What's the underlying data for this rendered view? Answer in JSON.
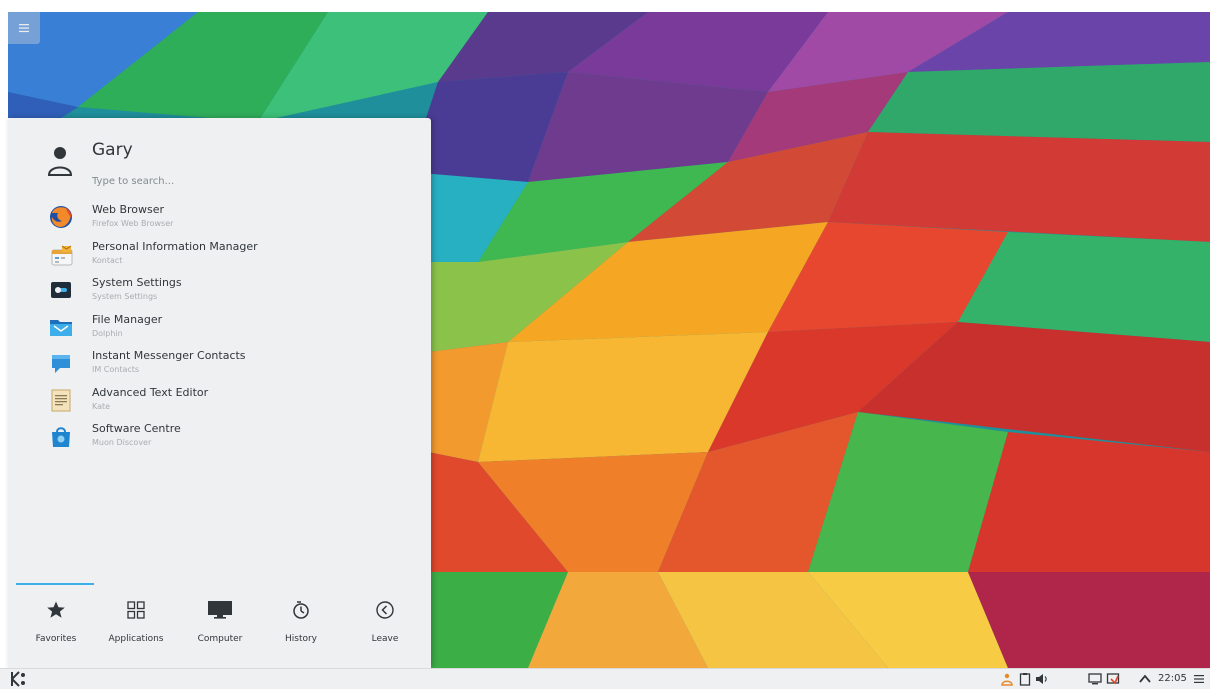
{
  "launcher": {
    "username": "Gary",
    "search_placeholder": "Type to search...",
    "favorites": [
      {
        "name": "Web Browser",
        "generic": "Firefox Web Browser",
        "icon": "firefox-icon"
      },
      {
        "name": "Personal Information Manager",
        "generic": "Kontact",
        "icon": "kontact-icon"
      },
      {
        "name": "System Settings",
        "generic": "System Settings",
        "icon": "system-settings-icon"
      },
      {
        "name": "File Manager",
        "generic": "Dolphin",
        "icon": "dolphin-icon"
      },
      {
        "name": "Instant Messenger Contacts",
        "generic": "IM Contacts",
        "icon": "im-contacts-icon"
      },
      {
        "name": "Advanced Text Editor",
        "generic": "Kate",
        "icon": "kate-icon"
      },
      {
        "name": "Software Centre",
        "generic": "Muon Discover",
        "icon": "discover-icon"
      }
    ],
    "tabs": [
      {
        "label": "Favorites",
        "icon": "star-icon"
      },
      {
        "label": "Applications",
        "icon": "grid-icon"
      },
      {
        "label": "Computer",
        "icon": "monitor-icon"
      },
      {
        "label": "History",
        "icon": "history-icon"
      },
      {
        "label": "Leave",
        "icon": "leave-icon"
      }
    ],
    "active_tab": "Favorites"
  },
  "panel": {
    "clock": "22:05"
  },
  "colors": {
    "accent": "#3daee9",
    "launcher_bg": "#eff0f1",
    "text": "#31363b"
  }
}
